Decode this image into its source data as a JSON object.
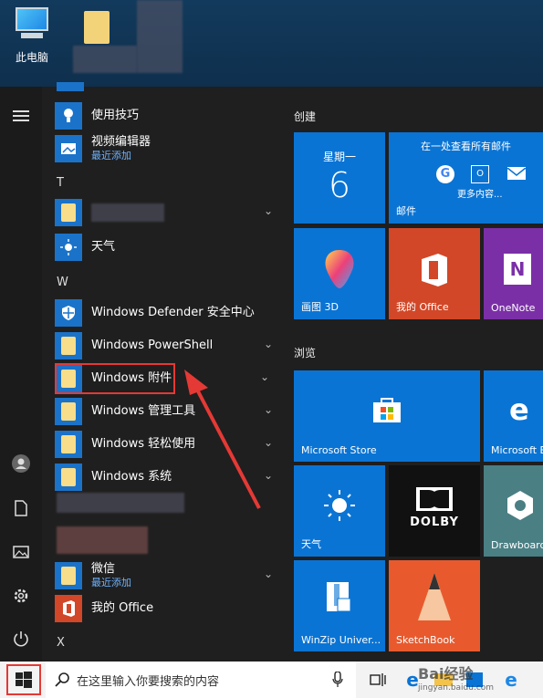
{
  "desktop": {
    "this_pc_label": "此电脑"
  },
  "start_menu": {
    "apps": [
      {
        "label": "使用技巧",
        "sub": "",
        "icon": "lightbulb-icon"
      },
      {
        "label": "视频编辑器",
        "sub": "最近添加",
        "icon": "video-editor-icon"
      },
      {
        "letter": "T"
      },
      {
        "label": "",
        "sub": "",
        "icon": "folder-icon",
        "blurred": true
      },
      {
        "label": "天气",
        "sub": "",
        "icon": "weather-icon"
      },
      {
        "letter": "W"
      },
      {
        "label": "Windows Defender 安全中心",
        "sub": "",
        "icon": "shield-icon"
      },
      {
        "label": "Windows PowerShell",
        "sub": "",
        "icon": "folder-icon"
      },
      {
        "label": "Windows 附件",
        "sub": "",
        "icon": "folder-icon",
        "highlighted": true
      },
      {
        "label": "Windows 管理工具",
        "sub": "",
        "icon": "folder-icon"
      },
      {
        "label": "Windows 轻松使用",
        "sub": "",
        "icon": "folder-icon"
      },
      {
        "label": "Windows 系统",
        "sub": "",
        "icon": "folder-icon"
      },
      {
        "label": "微信",
        "sub": "最近添加",
        "icon": "folder-icon"
      },
      {
        "label": "我的 Office",
        "sub": "",
        "icon": "office-icon"
      },
      {
        "letter": "X"
      }
    ],
    "groups": {
      "create": "创建",
      "browse": "浏览"
    },
    "tiles": {
      "calendar_day": "星期一",
      "calendar_date": "6",
      "mail_headline": "在一处查看所有邮件",
      "mail_more": "更多内容...",
      "mail_label": "邮件",
      "paint3d": "画图 3D",
      "my_office": "我的 Office",
      "onenote": "OneNote",
      "store": "Microsoft Store",
      "edge": "Microsoft Edge",
      "weather": "天气",
      "dolby": "DOLBY",
      "drawboard": "Drawboard",
      "winzip": "WinZip Univer...",
      "sketchbook": "SketchBook"
    }
  },
  "taskbar": {
    "search_placeholder": "在这里输入你要搜索的内容",
    "watermark": "Bai经验",
    "watermark_url": "jingyan.baidu.com"
  },
  "colors": {
    "accent_blue": "#0a74d4",
    "highlight_red": "#e53935"
  }
}
